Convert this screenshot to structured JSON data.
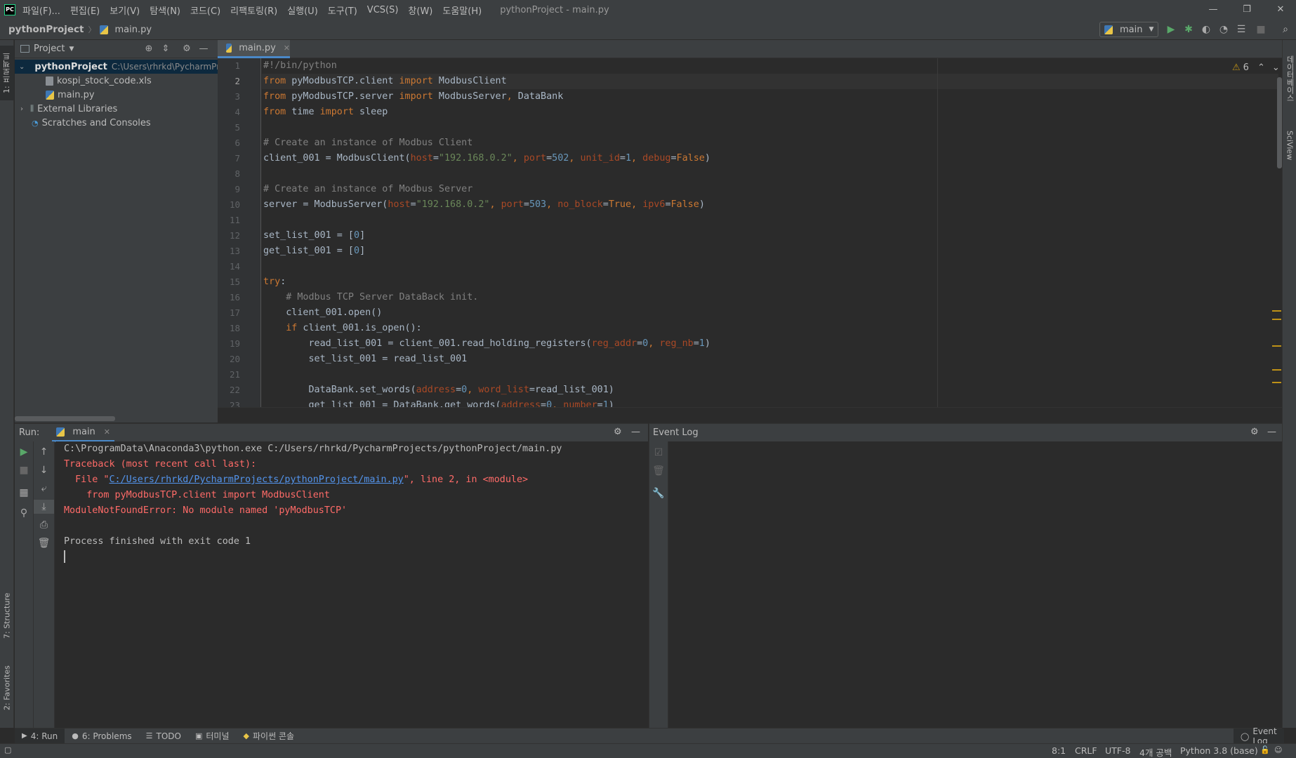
{
  "window": {
    "logo": "PC",
    "title": "pythonProject - main.py",
    "menu": [
      "파일(F)...",
      "편집(E)",
      "보기(V)",
      "탐색(N)",
      "코드(C)",
      "리팩토링(R)",
      "실행(U)",
      "도구(T)",
      "VCS(S)",
      "창(W)",
      "도움말(H)"
    ],
    "controls": {
      "minimize": "—",
      "restore": "❐",
      "close": "✕"
    }
  },
  "navbar": {
    "project": "pythonProject",
    "file": "main.py",
    "run_config": "main"
  },
  "left_strip": {
    "project_tab": "1: 프로젝트",
    "structure_tab": "7: Structure",
    "favorites_tab": "2: Favorites"
  },
  "right_strip": {
    "database_tab": "데이터베이스",
    "sciview_tab": "SciView"
  },
  "project_panel": {
    "title": "Project",
    "tree": [
      {
        "label": "pythonProject",
        "path": "C:\\Users\\rhrkd\\PycharmProjects\\pythonProject",
        "type": "project"
      },
      {
        "label": "kospi_stock_code.xls",
        "type": "xls"
      },
      {
        "label": "main.py",
        "type": "py"
      },
      {
        "label": "External Libraries",
        "type": "lib"
      },
      {
        "label": "Scratches and Consoles",
        "type": "scratch"
      }
    ]
  },
  "editor": {
    "tab_label": "main.py",
    "warnings": "6",
    "current_line": 2,
    "lines": [
      "1",
      "2",
      "3",
      "4",
      "5",
      "6",
      "7",
      "8",
      "9",
      "10",
      "11",
      "12",
      "13",
      "14",
      "15",
      "16",
      "17",
      "18",
      "19",
      "20",
      "21",
      "22",
      "23"
    ]
  },
  "run_panel": {
    "label": "Run:",
    "tab": "main",
    "console": [
      {
        "text": "C:\\ProgramData\\Anaconda3\\python.exe C:/Users/rhrkd/PycharmProjects/pythonProject/main.py",
        "kind": "normal"
      },
      {
        "text": "Traceback (most recent call last):",
        "kind": "err"
      },
      {
        "text_prefix": "  File \"",
        "link": "C:/Users/rhrkd/PycharmProjects/pythonProject/main.py",
        "text_suffix": "\", line 2, in <module>",
        "kind": "err"
      },
      {
        "text": "    from pyModbusTCP.client import ModbusClient",
        "kind": "err"
      },
      {
        "text": "ModuleNotFoundError: No module named 'pyModbusTCP'",
        "kind": "err"
      },
      {
        "text": "",
        "kind": "normal"
      },
      {
        "text": "Process finished with exit code 1",
        "kind": "normal"
      }
    ]
  },
  "event_log": {
    "title": "Event Log"
  },
  "bottom_tabs": {
    "run": "4: Run",
    "problems": "6: Problems",
    "todo": "TODO",
    "terminal": "터미널",
    "python_console": "파이썬 콘솔",
    "event_log": "Event Log"
  },
  "statusbar": {
    "position": "8:1",
    "line_sep": "CRLF",
    "encoding": "UTF-8",
    "indent": "4개 공백",
    "interpreter": "Python 3.8 (base)"
  }
}
